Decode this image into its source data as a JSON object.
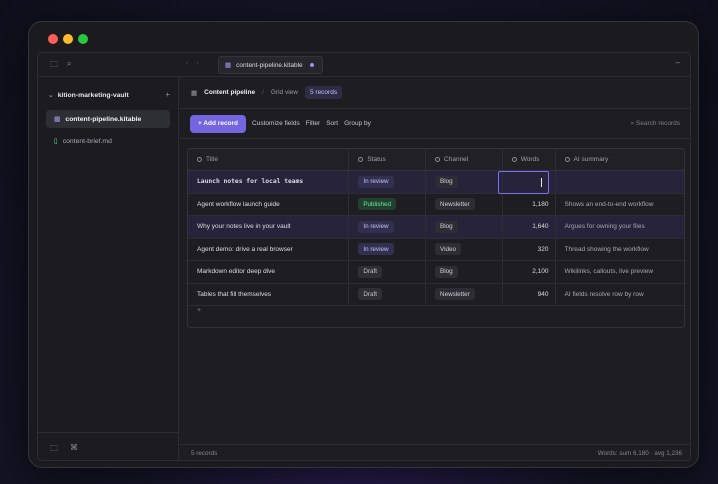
{
  "tab": {
    "filename": "content-pipeline.kitable"
  },
  "sidebar": {
    "vault_name": "kition-marketing-vault",
    "files": [
      {
        "name": "content-pipeline.kitable",
        "icon": "table-icon"
      },
      {
        "name": "content-brief.md",
        "icon": "document-icon"
      }
    ]
  },
  "breadcrumb": {
    "title": "Content pipeline",
    "separator": "/",
    "view": "Grid view",
    "records": "5 records"
  },
  "toolbar": {
    "add_record": "+ Add record",
    "customize": "Customize fields",
    "filter": "Filter",
    "sort": "Sort",
    "group": "Group by",
    "search_placeholder": "⌕ Search records"
  },
  "grid": {
    "columns": [
      "Title",
      "Status",
      "Channel",
      "Words",
      "AI summary"
    ],
    "rows": [
      {
        "title": "Launch notes for local teams",
        "status": "In review",
        "channel": "Blog",
        "words": "",
        "summary": ""
      },
      {
        "title": "Agent workflow launch guide",
        "status": "Published",
        "channel": "Newsletter",
        "words": "1,180",
        "summary": "Shows an end-to-end workflow"
      },
      {
        "title": "Why your notes live in your vault",
        "status": "In review",
        "channel": "Blog",
        "words": "1,640",
        "summary": "Argues for owning your files"
      },
      {
        "title": "Agent demo: drive a real browser",
        "status": "In review",
        "channel": "Video",
        "words": "320",
        "summary": "Thread showing the workflow"
      },
      {
        "title": "Markdown editor deep dive",
        "status": "Draft",
        "channel": "Blog",
        "words": "2,100",
        "summary": "Wikilinks, callouts, live preview"
      },
      {
        "title": "Tables that fill themselves",
        "status": "Draft",
        "channel": "Newsletter",
        "words": "940",
        "summary": "AI fields resolve row by row"
      }
    ],
    "add_row": "+"
  },
  "statusbar": {
    "count": "5 records",
    "summary": "Words: sum 6,180 · avg 1,236"
  },
  "colors": {
    "accent": "#7366e0",
    "published": "#6ee7a0",
    "in_review": "#c6bfff"
  }
}
